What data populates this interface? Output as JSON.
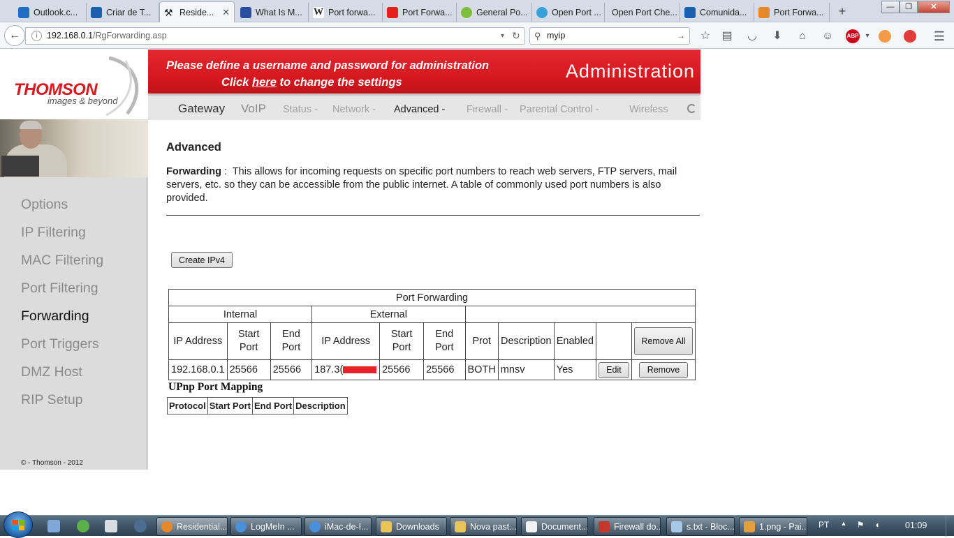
{
  "browser": {
    "tabs": [
      {
        "label": "Outlook.c...",
        "icon_color": "#1e6fc4"
      },
      {
        "label": "Criar de T...",
        "icon_color": "#1b5fb0"
      },
      {
        "label": "Reside...",
        "icon_color": "#555555"
      },
      {
        "label": "What Is M...",
        "icon_color": "#2a4f9e"
      },
      {
        "label": "Port forwa...",
        "icon_color": "#ffffff"
      },
      {
        "label": "Port Forwa...",
        "icon_color": "#e62117"
      },
      {
        "label": "General Po...",
        "icon_color": "#7fbf3f"
      },
      {
        "label": "Open Port ...",
        "icon_color": "#3aa0d8"
      },
      {
        "label": "Open Port Che...",
        "icon_color": "#d6dce6"
      },
      {
        "label": "Comunida...",
        "icon_color": "#1b5fb0"
      },
      {
        "label": "Port Forwa...",
        "icon_color": "#e8862a"
      }
    ],
    "wikipedia_glyph": "W",
    "new_tab": "+",
    "window_buttons": {
      "minimize": "—",
      "maximize": "❐",
      "close": "✕"
    },
    "url_host": "192.168.0.1",
    "url_path": "/RgForwarding.asp",
    "search_value": "myip",
    "toolbar_icons": [
      "star-icon",
      "reading-list-icon",
      "pocket-icon",
      "download-icon",
      "home-icon",
      "chat-icon",
      "adblock-icon",
      "extension-icon",
      "extension-icon-2",
      "menu-icon"
    ],
    "adblock_label": "ABP"
  },
  "colors": {
    "brand_red": "#d71920",
    "sidebar_bg": "#dcdcdc",
    "redaction": "#e8232a"
  },
  "brand": {
    "name": "THOMSON",
    "tagline": "images & beyond"
  },
  "banner": {
    "line1": "Please define a username and password for administration",
    "line2_pre": "Click ",
    "line2_link": "here",
    "line2_post": " to change the settings",
    "admin": "Administration"
  },
  "topnav": {
    "gateway": "Gateway",
    "voip": "VoIP",
    "items": [
      "Status -",
      "Network -",
      "Advanced -",
      "Firewall -",
      "Parental Control -",
      "Wireless"
    ]
  },
  "sidebar": {
    "items": [
      "Options",
      "IP Filtering",
      "MAC Filtering",
      "Port Filtering",
      "Forwarding",
      "Port Triggers",
      "DMZ Host",
      "RIP Setup"
    ],
    "active": "Forwarding",
    "copyright": "© - Thomson - 2012"
  },
  "content": {
    "title": "Advanced",
    "desc_label": "Forwarding",
    "desc_sep": " :  ",
    "desc_text": "This allows for incoming requests on specific port numbers to reach web servers, FTP servers, mail servers, etc. so they can be accessible from the public internet. A table of commonly used port numbers is also provided.",
    "create_button": "Create IPv4"
  },
  "port_forwarding": {
    "caption": "Port Forwarding",
    "group_internal": "Internal",
    "group_external": "External",
    "headers": [
      "IP Address",
      "Start Port",
      "End Port",
      "IP Address",
      "Start Port",
      "End Port",
      "Prot",
      "Description",
      "Enabled"
    ],
    "remove_all": "Remove All",
    "rows": [
      {
        "internal_ip": "192.168.0.1",
        "internal_start": "25566",
        "internal_end": "25566",
        "external_ip": "187.3(",
        "external_start": "25566",
        "external_end": "25566",
        "protocol": "BOTH",
        "description": "mnsv",
        "enabled": "Yes",
        "edit": "Edit",
        "remove": "Remove"
      }
    ]
  },
  "upnp": {
    "title": "UPnp Port Mapping",
    "headers": [
      "Protocol",
      "Start Port",
      "End Port",
      "Description"
    ]
  },
  "taskbar": {
    "tasks": [
      {
        "label": "Residential...",
        "icon_color": "#e8862a"
      },
      {
        "label": "LogMeIn ...",
        "icon_color": "#4a8fd8"
      },
      {
        "label": "iMac-de-I...",
        "icon_color": "#4a8fd8"
      },
      {
        "label": "Downloads",
        "icon_color": "#e8c45a"
      },
      {
        "label": "Nova past...",
        "icon_color": "#e8c45a"
      },
      {
        "label": "Document...",
        "icon_color": "#f2f2f2"
      },
      {
        "label": "Firewall do...",
        "icon_color": "#c0392b"
      },
      {
        "label": "s.txt - Bloc...",
        "icon_color": "#a8c8e8"
      },
      {
        "label": "1.png - Pai...",
        "icon_color": "#e0a040"
      }
    ],
    "language": "PT",
    "clock": "01:09"
  }
}
